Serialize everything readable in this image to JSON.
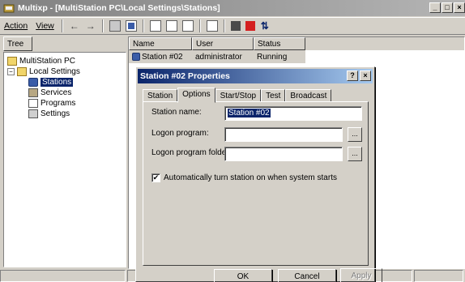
{
  "app": {
    "title": "Multixp - [MultiStation PC\\Local Settings\\Stations]",
    "window_buttons": [
      "_",
      "□",
      "×"
    ]
  },
  "menu": {
    "action": "Action",
    "view": "View"
  },
  "toolbar": {
    "back_glyph": "←",
    "forward_glyph": "→",
    "refresh_glyph": "⇅"
  },
  "tree": {
    "header": "Tree",
    "root": "MultiStation PC",
    "local_settings": "Local Settings",
    "expander": "−",
    "items": [
      "Stations",
      "Services",
      "Programs",
      "Settings"
    ]
  },
  "list": {
    "columns": [
      "Name",
      "User",
      "Status"
    ],
    "rows": [
      {
        "name": "Station #02",
        "user": "administrator",
        "status": "Running"
      }
    ]
  },
  "dialog": {
    "title": "Station #02 Properties",
    "help_btn": "?",
    "close_btn": "×",
    "tabs": [
      "Station",
      "Options",
      "Start/Stop",
      "Test",
      "Broadcast"
    ],
    "active_tab": "Options",
    "station_name_label": "Station name:",
    "station_name_value": "Station #02",
    "logon_program_label": "Logon program:",
    "logon_program_value": "",
    "logon_folder_label": "Logon program folder:",
    "logon_folder_value": "",
    "browse_label": "...",
    "auto_start_label": "Automatically turn station on when system starts",
    "auto_start_checked": "✔",
    "ok": "OK",
    "cancel": "Cancel",
    "apply": "Apply"
  }
}
